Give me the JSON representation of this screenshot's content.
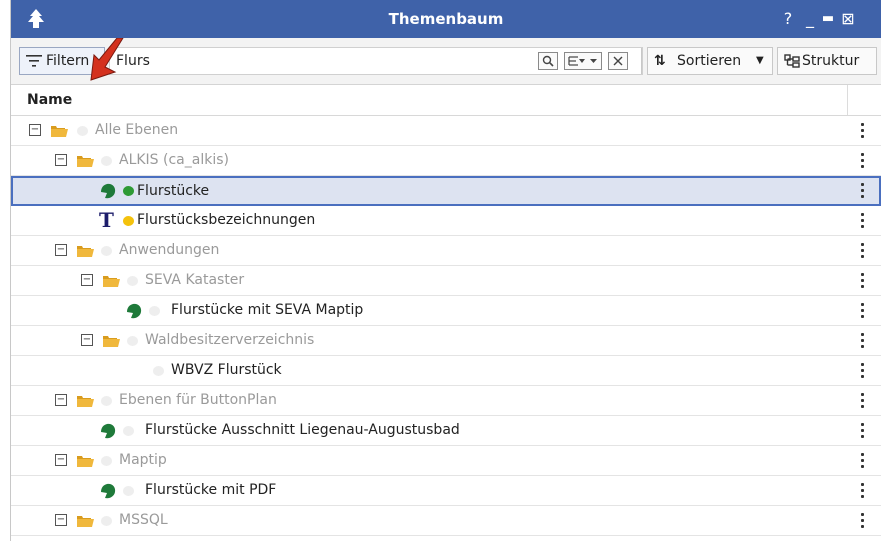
{
  "window": {
    "title": "Themenbaum",
    "controls": {
      "help": "?",
      "minimize": "_",
      "maximize": "▬",
      "close": "⊠"
    },
    "accent_color": "#3f62a9"
  },
  "toolbar": {
    "filter_label": "Filtern",
    "search_value": "Flurs",
    "search_icon": "magnifier-icon",
    "filter_mode_icon": "tree-filter-icon",
    "clear_icon": "clear-icon",
    "sort_label": "Sortieren",
    "structure_label": "Struktur"
  },
  "columns": {
    "name": "Name"
  },
  "rows": [
    {
      "label": "Alle Ebenen",
      "type": "folder",
      "muted": true
    },
    {
      "label": "ALKIS (ca_alkis)",
      "type": "folder",
      "muted": true
    },
    {
      "label": "Flurstücke",
      "type": "layer",
      "dot": "#2e9a35",
      "selected": true
    },
    {
      "label": "Flurstücksbezeichnungen",
      "type": "text-layer",
      "dot": "#f4c20d"
    },
    {
      "label": "Anwendungen",
      "type": "folder",
      "muted": true
    },
    {
      "label": "SEVA Kataster",
      "type": "folder",
      "muted": true
    },
    {
      "label": "Flurstücke mit SEVA Maptip",
      "type": "layer"
    },
    {
      "label": "Waldbesitzerverzeichnis",
      "type": "folder",
      "muted": true
    },
    {
      "label": "WBVZ Flurstück",
      "type": "item"
    },
    {
      "label": "Ebenen für ButtonPlan",
      "type": "folder",
      "muted": true
    },
    {
      "label": "Flurstücke Ausschnitt Liegenau-Augustusbad",
      "type": "layer"
    },
    {
      "label": "Maptip",
      "type": "folder",
      "muted": true
    },
    {
      "label": "Flurstücke mit PDF",
      "type": "layer"
    },
    {
      "label": "MSSQL",
      "type": "folder",
      "muted": true
    }
  ]
}
